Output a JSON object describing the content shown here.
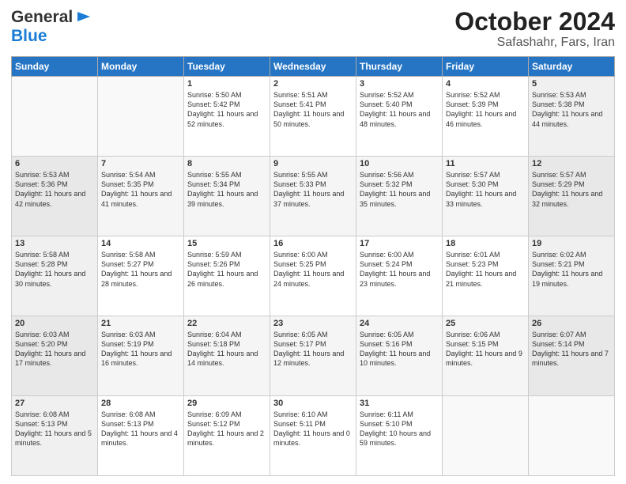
{
  "header": {
    "logo_general": "General",
    "logo_blue": "Blue",
    "month": "October 2024",
    "location": "Safashahr, Fars, Iran"
  },
  "days_of_week": [
    "Sunday",
    "Monday",
    "Tuesday",
    "Wednesday",
    "Thursday",
    "Friday",
    "Saturday"
  ],
  "weeks": [
    [
      {
        "day": "",
        "sunrise": "",
        "sunset": "",
        "daylight": ""
      },
      {
        "day": "",
        "sunrise": "",
        "sunset": "",
        "daylight": ""
      },
      {
        "day": "1",
        "sunrise": "Sunrise: 5:50 AM",
        "sunset": "Sunset: 5:42 PM",
        "daylight": "Daylight: 11 hours and 52 minutes."
      },
      {
        "day": "2",
        "sunrise": "Sunrise: 5:51 AM",
        "sunset": "Sunset: 5:41 PM",
        "daylight": "Daylight: 11 hours and 50 minutes."
      },
      {
        "day": "3",
        "sunrise": "Sunrise: 5:52 AM",
        "sunset": "Sunset: 5:40 PM",
        "daylight": "Daylight: 11 hours and 48 minutes."
      },
      {
        "day": "4",
        "sunrise": "Sunrise: 5:52 AM",
        "sunset": "Sunset: 5:39 PM",
        "daylight": "Daylight: 11 hours and 46 minutes."
      },
      {
        "day": "5",
        "sunrise": "Sunrise: 5:53 AM",
        "sunset": "Sunset: 5:38 PM",
        "daylight": "Daylight: 11 hours and 44 minutes."
      }
    ],
    [
      {
        "day": "6",
        "sunrise": "Sunrise: 5:53 AM",
        "sunset": "Sunset: 5:36 PM",
        "daylight": "Daylight: 11 hours and 42 minutes."
      },
      {
        "day": "7",
        "sunrise": "Sunrise: 5:54 AM",
        "sunset": "Sunset: 5:35 PM",
        "daylight": "Daylight: 11 hours and 41 minutes."
      },
      {
        "day": "8",
        "sunrise": "Sunrise: 5:55 AM",
        "sunset": "Sunset: 5:34 PM",
        "daylight": "Daylight: 11 hours and 39 minutes."
      },
      {
        "day": "9",
        "sunrise": "Sunrise: 5:55 AM",
        "sunset": "Sunset: 5:33 PM",
        "daylight": "Daylight: 11 hours and 37 minutes."
      },
      {
        "day": "10",
        "sunrise": "Sunrise: 5:56 AM",
        "sunset": "Sunset: 5:32 PM",
        "daylight": "Daylight: 11 hours and 35 minutes."
      },
      {
        "day": "11",
        "sunrise": "Sunrise: 5:57 AM",
        "sunset": "Sunset: 5:30 PM",
        "daylight": "Daylight: 11 hours and 33 minutes."
      },
      {
        "day": "12",
        "sunrise": "Sunrise: 5:57 AM",
        "sunset": "Sunset: 5:29 PM",
        "daylight": "Daylight: 11 hours and 32 minutes."
      }
    ],
    [
      {
        "day": "13",
        "sunrise": "Sunrise: 5:58 AM",
        "sunset": "Sunset: 5:28 PM",
        "daylight": "Daylight: 11 hours and 30 minutes."
      },
      {
        "day": "14",
        "sunrise": "Sunrise: 5:58 AM",
        "sunset": "Sunset: 5:27 PM",
        "daylight": "Daylight: 11 hours and 28 minutes."
      },
      {
        "day": "15",
        "sunrise": "Sunrise: 5:59 AM",
        "sunset": "Sunset: 5:26 PM",
        "daylight": "Daylight: 11 hours and 26 minutes."
      },
      {
        "day": "16",
        "sunrise": "Sunrise: 6:00 AM",
        "sunset": "Sunset: 5:25 PM",
        "daylight": "Daylight: 11 hours and 24 minutes."
      },
      {
        "day": "17",
        "sunrise": "Sunrise: 6:00 AM",
        "sunset": "Sunset: 5:24 PM",
        "daylight": "Daylight: 11 hours and 23 minutes."
      },
      {
        "day": "18",
        "sunrise": "Sunrise: 6:01 AM",
        "sunset": "Sunset: 5:23 PM",
        "daylight": "Daylight: 11 hours and 21 minutes."
      },
      {
        "day": "19",
        "sunrise": "Sunrise: 6:02 AM",
        "sunset": "Sunset: 5:21 PM",
        "daylight": "Daylight: 11 hours and 19 minutes."
      }
    ],
    [
      {
        "day": "20",
        "sunrise": "Sunrise: 6:03 AM",
        "sunset": "Sunset: 5:20 PM",
        "daylight": "Daylight: 11 hours and 17 minutes."
      },
      {
        "day": "21",
        "sunrise": "Sunrise: 6:03 AM",
        "sunset": "Sunset: 5:19 PM",
        "daylight": "Daylight: 11 hours and 16 minutes."
      },
      {
        "day": "22",
        "sunrise": "Sunrise: 6:04 AM",
        "sunset": "Sunset: 5:18 PM",
        "daylight": "Daylight: 11 hours and 14 minutes."
      },
      {
        "day": "23",
        "sunrise": "Sunrise: 6:05 AM",
        "sunset": "Sunset: 5:17 PM",
        "daylight": "Daylight: 11 hours and 12 minutes."
      },
      {
        "day": "24",
        "sunrise": "Sunrise: 6:05 AM",
        "sunset": "Sunset: 5:16 PM",
        "daylight": "Daylight: 11 hours and 10 minutes."
      },
      {
        "day": "25",
        "sunrise": "Sunrise: 6:06 AM",
        "sunset": "Sunset: 5:15 PM",
        "daylight": "Daylight: 11 hours and 9 minutes."
      },
      {
        "day": "26",
        "sunrise": "Sunrise: 6:07 AM",
        "sunset": "Sunset: 5:14 PM",
        "daylight": "Daylight: 11 hours and 7 minutes."
      }
    ],
    [
      {
        "day": "27",
        "sunrise": "Sunrise: 6:08 AM",
        "sunset": "Sunset: 5:13 PM",
        "daylight": "Daylight: 11 hours and 5 minutes."
      },
      {
        "day": "28",
        "sunrise": "Sunrise: 6:08 AM",
        "sunset": "Sunset: 5:13 PM",
        "daylight": "Daylight: 11 hours and 4 minutes."
      },
      {
        "day": "29",
        "sunrise": "Sunrise: 6:09 AM",
        "sunset": "Sunset: 5:12 PM",
        "daylight": "Daylight: 11 hours and 2 minutes."
      },
      {
        "day": "30",
        "sunrise": "Sunrise: 6:10 AM",
        "sunset": "Sunset: 5:11 PM",
        "daylight": "Daylight: 11 hours and 0 minutes."
      },
      {
        "day": "31",
        "sunrise": "Sunrise: 6:11 AM",
        "sunset": "Sunset: 5:10 PM",
        "daylight": "Daylight: 10 hours and 59 minutes."
      },
      {
        "day": "",
        "sunrise": "",
        "sunset": "",
        "daylight": ""
      },
      {
        "day": "",
        "sunrise": "",
        "sunset": "",
        "daylight": ""
      }
    ]
  ]
}
